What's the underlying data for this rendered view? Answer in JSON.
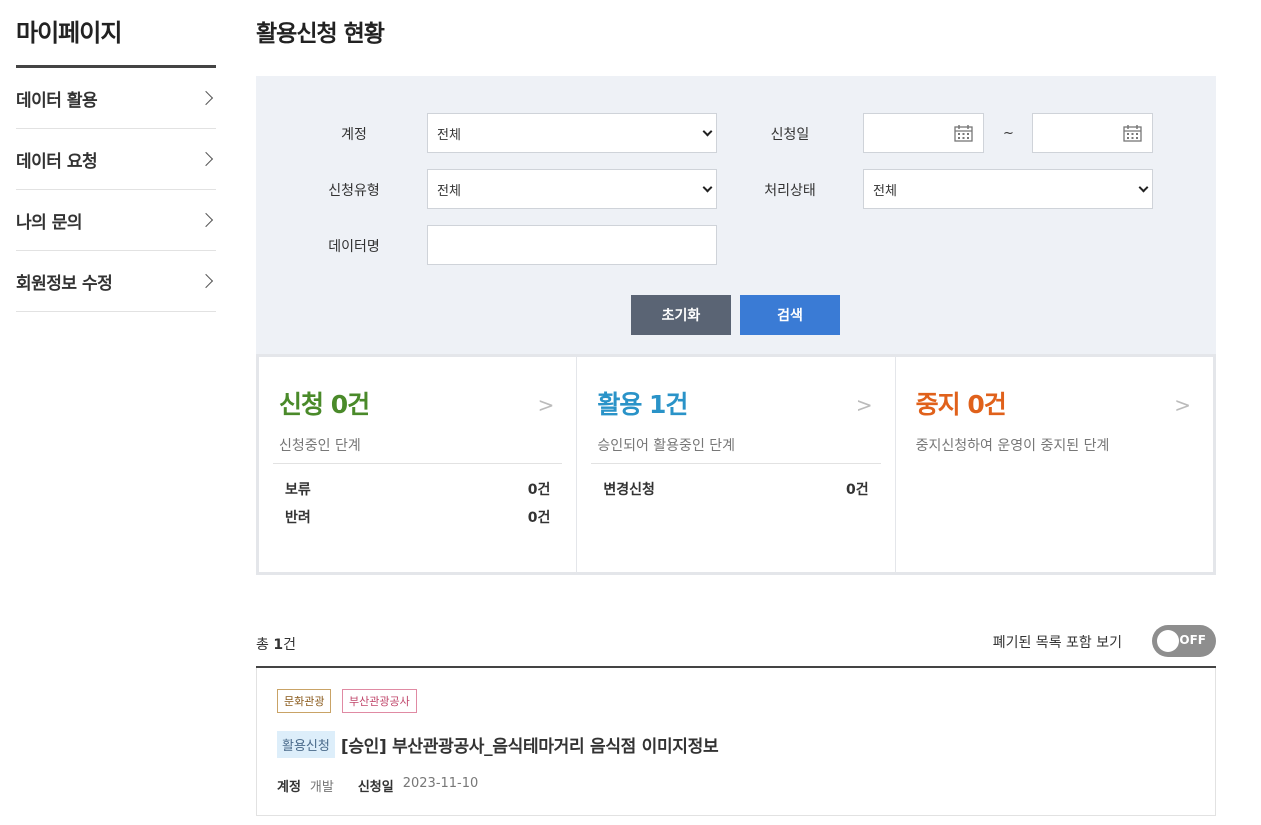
{
  "sidebar": {
    "title": "마이페이지",
    "items": [
      {
        "label": "데이터 활용"
      },
      {
        "label": "데이터 요청"
      },
      {
        "label": "나의 문의"
      },
      {
        "label": "회원정보 수정"
      }
    ]
  },
  "page": {
    "title": "활용신청 현황"
  },
  "filter": {
    "account_label": "계정",
    "account_value": "전체",
    "date_label": "신청일",
    "date_from": "",
    "date_sep": "~",
    "date_to": "",
    "type_label": "신청유형",
    "type_value": "전체",
    "status_label": "처리상태",
    "status_value": "전체",
    "dataname_label": "데이터명",
    "dataname_value": "",
    "reset_label": "초기화",
    "search_label": "검색"
  },
  "status_cards": [
    {
      "title": "신청 0건",
      "color": "#4a8a2a",
      "more": ">",
      "desc": "신청중인 단계",
      "rows": [
        {
          "label": "보류",
          "count": "0건"
        },
        {
          "label": "반려",
          "count": "0건"
        }
      ]
    },
    {
      "title": "활용 1건",
      "color": "#2a93c8",
      "more": ">",
      "desc": "승인되어 활용중인 단계",
      "rows": [
        {
          "label": "변경신청",
          "count": "0건"
        }
      ]
    },
    {
      "title": "중지 0건",
      "color": "#e0611b",
      "more": ">",
      "desc": "중지신청하여 운영이 중지된 단계",
      "rows": []
    }
  ],
  "list": {
    "total_prefix": "총",
    "total_count": "1",
    "total_suffix": "건",
    "include_label": "폐기된 목록 포함 보기",
    "toggle_text": "OFF",
    "items": [
      {
        "tags": [
          "문화관광",
          "부산관광공사"
        ],
        "type": "활용신청",
        "title": "[승인] 부산관광공사_음식테마거리 음식점 이미지정보",
        "account_label": "계정",
        "account_value": "개발",
        "date_label": "신청일",
        "date_value": "2023-11-10"
      }
    ]
  }
}
